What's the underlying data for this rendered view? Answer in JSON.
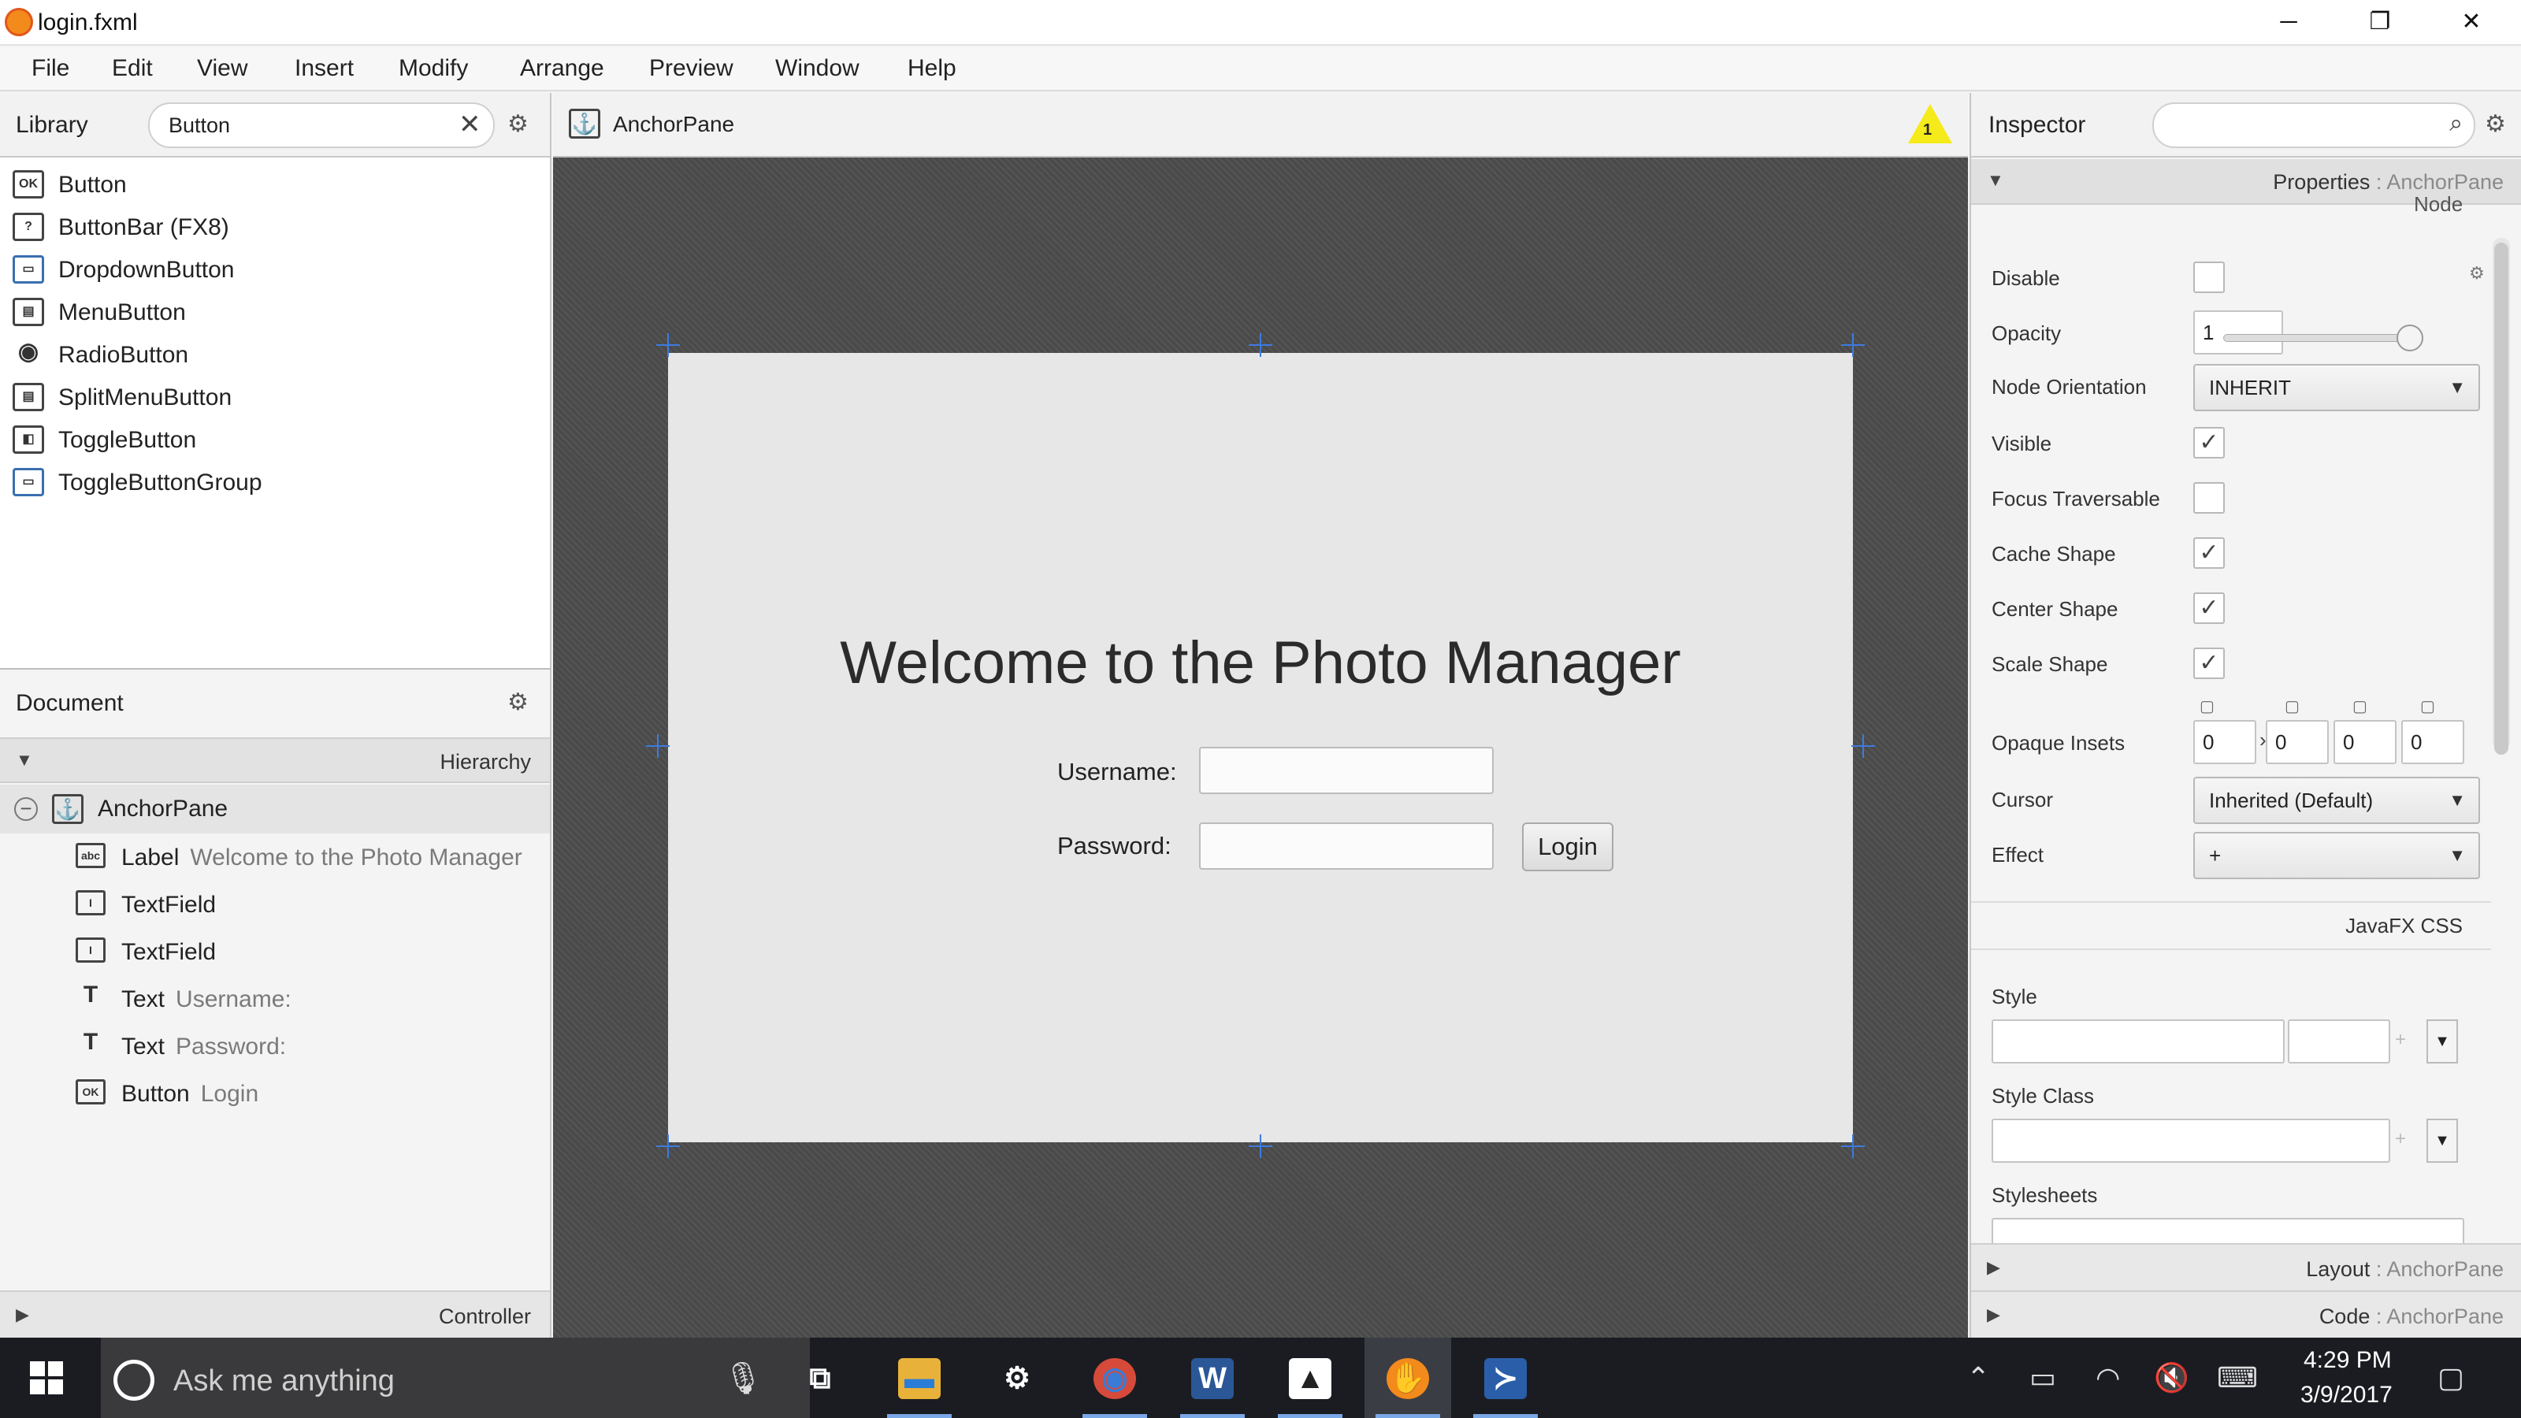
{
  "window": {
    "title": "login.fxml",
    "minimize": "─",
    "restore": "❐",
    "close": "✕"
  },
  "menubar": [
    "File",
    "Edit",
    "View",
    "Insert",
    "Modify",
    "Arrange",
    "Preview",
    "Window",
    "Help"
  ],
  "library": {
    "title": "Library",
    "search_value": "Button",
    "items": [
      {
        "label": "Button",
        "icon": "OK"
      },
      {
        "label": "ButtonBar  (FX8)",
        "icon": "?"
      },
      {
        "label": "DropdownButton",
        "icon": "▭"
      },
      {
        "label": "MenuButton",
        "icon": "▤"
      },
      {
        "label": "RadioButton",
        "icon": "◉"
      },
      {
        "label": "SplitMenuButton",
        "icon": "▤"
      },
      {
        "label": "ToggleButton",
        "icon": "◧"
      },
      {
        "label": "ToggleButtonGroup",
        "icon": "▭"
      }
    ]
  },
  "document": {
    "title": "Document",
    "hierarchy_label": "Hierarchy",
    "controller_label": "Controller",
    "root": {
      "type": "AnchorPane",
      "collapse": "−"
    },
    "children": [
      {
        "type": "Label",
        "desc": "Welcome to the Photo Manager",
        "icon": "abc"
      },
      {
        "type": "TextField",
        "desc": "",
        "icon": "I"
      },
      {
        "type": "TextField",
        "desc": "",
        "icon": "I"
      },
      {
        "type": "Text",
        "desc": "Username:",
        "icon": "T"
      },
      {
        "type": "Text",
        "desc": "Password:",
        "icon": "T"
      },
      {
        "type": "Button",
        "desc": "Login",
        "icon": "OK"
      }
    ]
  },
  "content": {
    "breadcrumb": "AnchorPane",
    "warning_count": "1",
    "welcome": "Welcome to the Photo Manager",
    "username_label": "Username:",
    "password_label": "Password:",
    "login_button": "Login"
  },
  "inspector": {
    "title": "Inspector",
    "properties_label": "Properties",
    "properties_target": ": AnchorPane",
    "node_label": "Node",
    "disable": "Disable",
    "opacity": "Opacity",
    "opacity_value": "1",
    "node_orientation": "Node Orientation",
    "node_orientation_value": "INHERIT",
    "visible": "Visible",
    "focus_traversable": "Focus Traversable",
    "cache_shape": "Cache Shape",
    "center_shape": "Center Shape",
    "scale_shape": "Scale Shape",
    "opaque_insets": "Opaque Insets",
    "insets": [
      "0",
      "0",
      "0",
      "0"
    ],
    "cursor": "Cursor",
    "cursor_value": "Inherited (Default)",
    "effect": "Effect",
    "effect_value": "+",
    "javafx_css": "JavaFX CSS",
    "style": "Style",
    "style_class": "Style Class",
    "stylesheets": "Stylesheets",
    "plus": "+",
    "layout_label": "Layout",
    "layout_target": ": AnchorPane",
    "code_label": "Code",
    "code_target": ": AnchorPane",
    "check_mark": "✓"
  },
  "taskbar": {
    "search_placeholder": "Ask me anything",
    "time": "4:29 PM",
    "date": "3/9/2017",
    "apps": [
      {
        "name": "task-view",
        "glyph": "⧉",
        "color": "#1b1c22"
      },
      {
        "name": "file-explorer",
        "glyph": "▬",
        "color": "#e8b23a"
      },
      {
        "name": "settings",
        "glyph": "⚙",
        "color": "#1b1c22"
      },
      {
        "name": "chrome",
        "glyph": "◉",
        "color": "#d64a3a"
      },
      {
        "name": "word",
        "glyph": "W",
        "color": "#2b5797"
      },
      {
        "name": "photos",
        "glyph": "▲",
        "color": "#1b1c22"
      },
      {
        "name": "scene-builder",
        "glyph": "✋",
        "color": "#f28a1c"
      },
      {
        "name": "powershell",
        "glyph": "≻",
        "color": "#2a5ea8"
      }
    ],
    "tray": [
      "⌃",
      "▭",
      "◠",
      "🔇",
      "⌨",
      "▢"
    ]
  }
}
